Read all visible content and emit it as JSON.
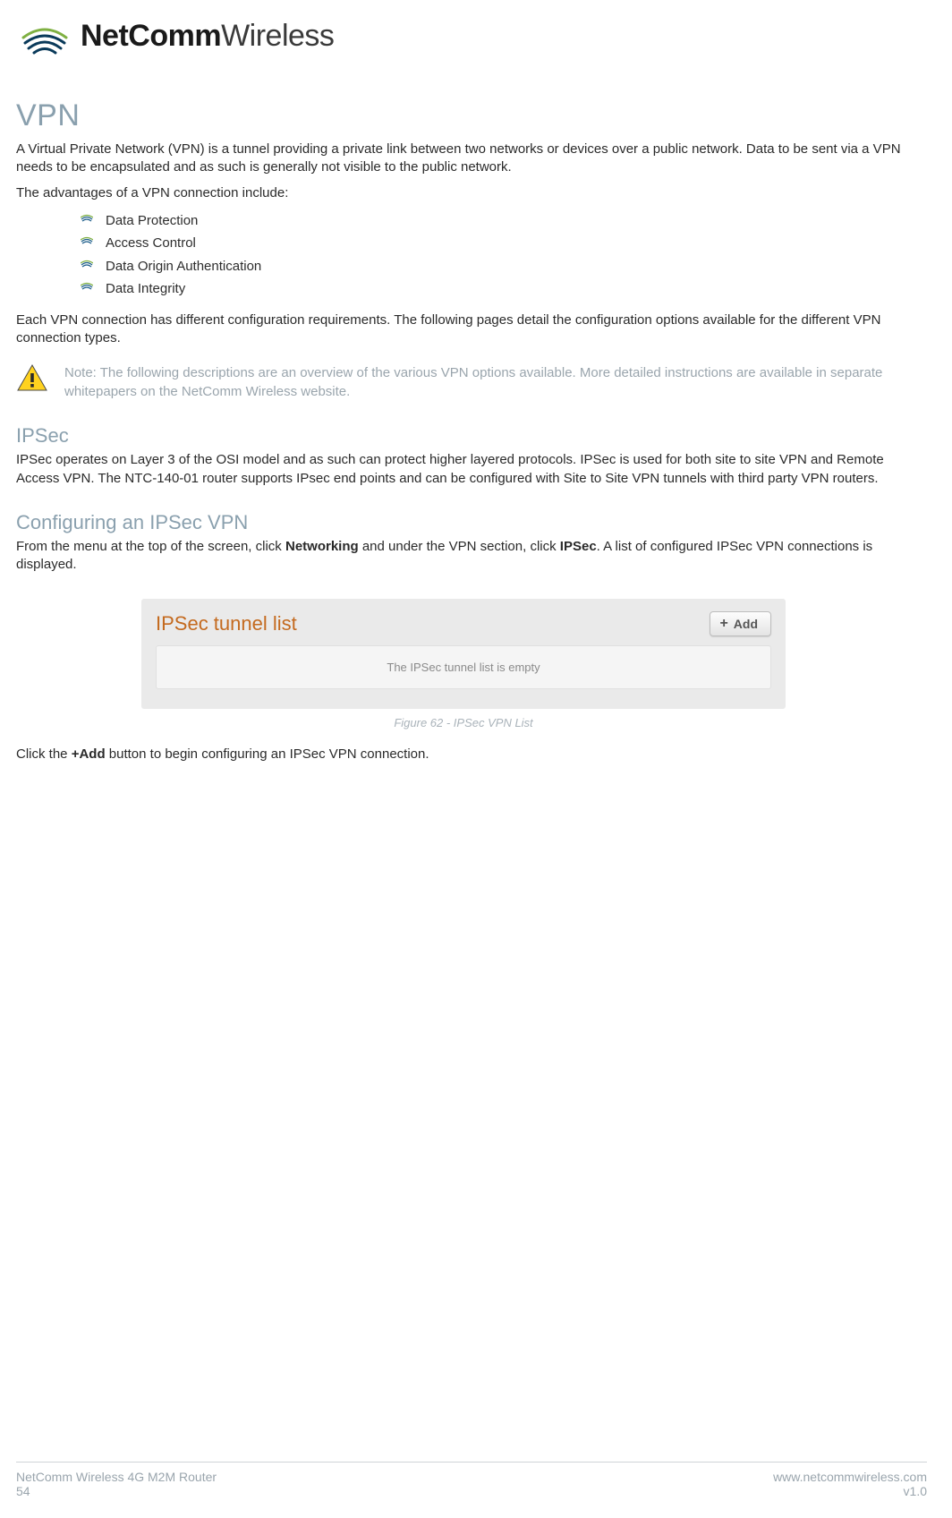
{
  "logo": {
    "bold": "NetComm",
    "light": "Wireless"
  },
  "h1": "VPN",
  "intro1": "A Virtual Private Network (VPN) is a tunnel providing a private link between two networks or devices over a public network. Data to be sent via a VPN needs to be encapsulated and as such is generally not visible to the public network.",
  "intro2": "The advantages of a VPN connection include:",
  "bullets": {
    "b0": "Data Protection",
    "b1": "Access Control",
    "b2": "Data Origin Authentication",
    "b3": "Data Integrity"
  },
  "para2": "Each VPN connection has different configuration requirements. The following pages detail the configuration options available for the different VPN connection types.",
  "note": "Note: The following descriptions are an overview of the various VPN options available. More detailed instructions are available in separate whitepapers on the NetComm Wireless website.",
  "ipsec": {
    "title": "IPSec",
    "body": "IPSec operates on Layer 3 of the OSI model and as such can protect higher layered protocols. IPSec is used for both site to site VPN and Remote Access VPN. The NTC-140-01 router supports IPsec end points and can be configured with Site to Site VPN tunnels with third party VPN routers."
  },
  "config": {
    "title": "Configuring an IPSec VPN",
    "lead_pre": "From the menu at the top of the screen, click ",
    "lead_strong1": "Networking",
    "lead_mid": " and under the VPN section, click ",
    "lead_strong2": "IPSec",
    "lead_post": ". A list of configured IPSec VPN connections is displayed."
  },
  "panel": {
    "title": "IPSec tunnel list",
    "add_label": "Add",
    "empty": "The IPSec tunnel list is empty"
  },
  "fig_caption": "Figure 62 - IPSec VPN List",
  "click_add": {
    "pre": "Click the ",
    "strong": "+Add",
    "post": " button to begin configuring an IPSec VPN connection."
  },
  "footer": {
    "product": "NetComm Wireless 4G M2M Router",
    "page": "54",
    "url": "www.netcommwireless.com",
    "version": "v1.0"
  }
}
